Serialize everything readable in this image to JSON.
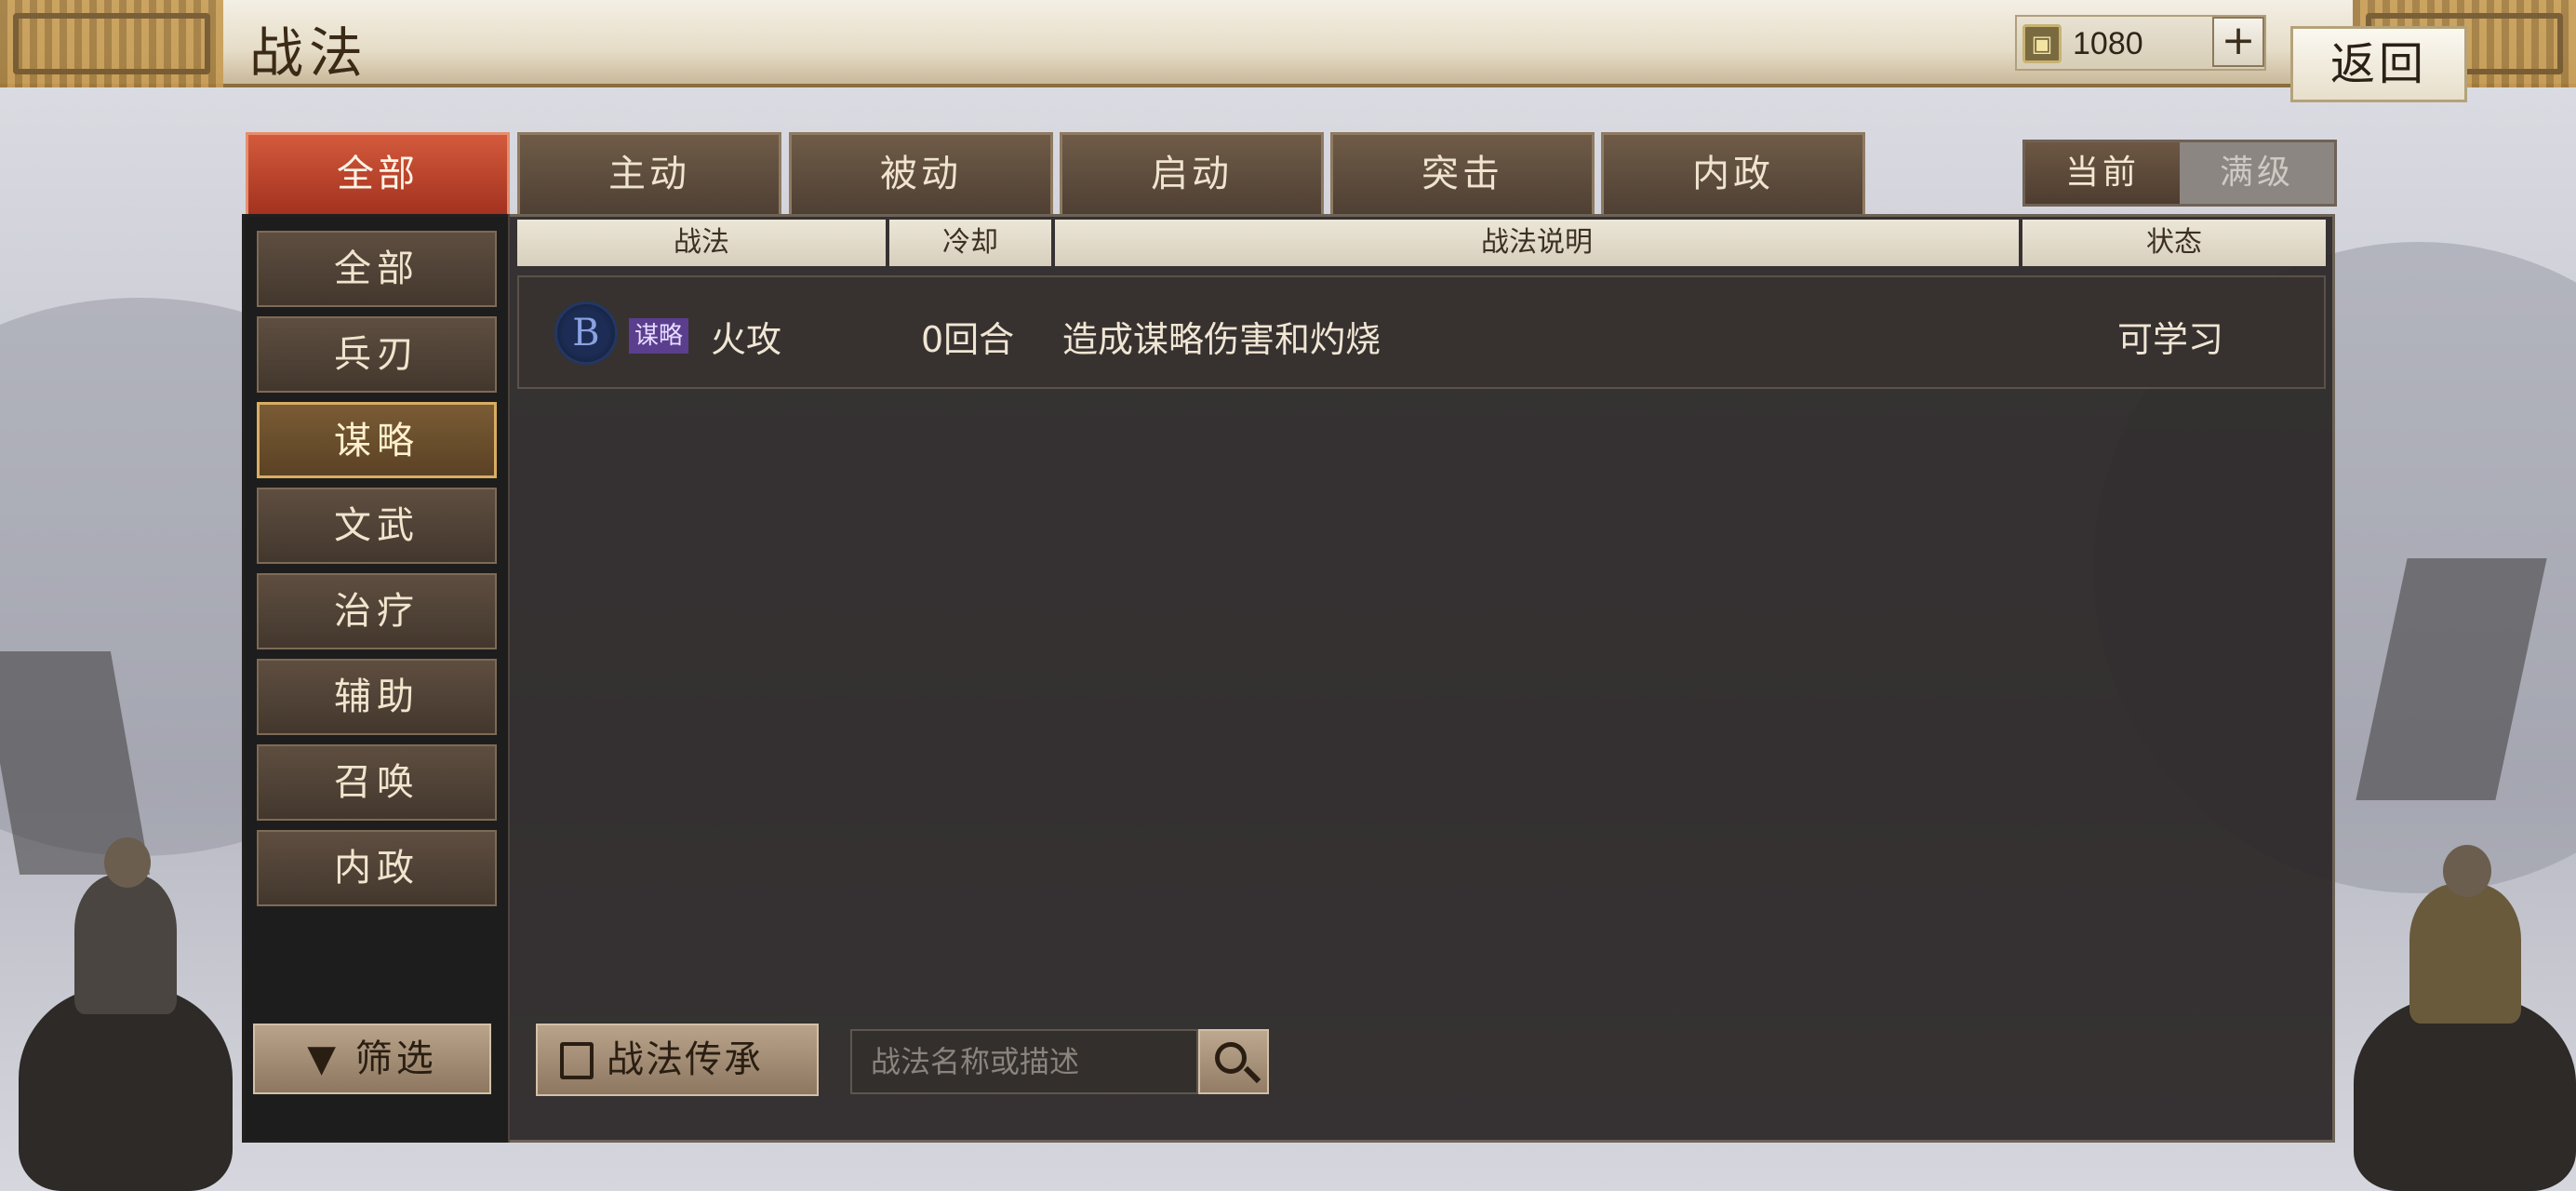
{
  "header": {
    "title": "战法",
    "currency_value": "1080",
    "currency_icon": "treasure-box-icon",
    "plus_label": "+",
    "back_label": "返回"
  },
  "tabs": [
    {
      "label": "全部",
      "active": true
    },
    {
      "label": "主动",
      "active": false
    },
    {
      "label": "被动",
      "active": false
    },
    {
      "label": "启动",
      "active": false
    },
    {
      "label": "突击",
      "active": false
    },
    {
      "label": "内政",
      "active": false
    }
  ],
  "level_toggle": {
    "current": "当前",
    "max": "满级",
    "selected": "当前"
  },
  "sidebar": {
    "items": [
      {
        "label": "全部",
        "active": false
      },
      {
        "label": "兵刃",
        "active": false
      },
      {
        "label": "谋略",
        "active": true
      },
      {
        "label": "文武",
        "active": false
      },
      {
        "label": "治疗",
        "active": false
      },
      {
        "label": "辅助",
        "active": false
      },
      {
        "label": "召唤",
        "active": false
      },
      {
        "label": "内政",
        "active": false
      }
    ],
    "filter_label": "筛选"
  },
  "table": {
    "columns": [
      "战法",
      "冷却",
      "战法说明",
      "状态"
    ],
    "rows": [
      {
        "grade": "B",
        "type": "谋略",
        "name": "火攻",
        "cooldown": "0回合",
        "description": "造成谋略伤害和灼烧",
        "status": "可学习"
      }
    ]
  },
  "bottom": {
    "inherit_label": "战法传承",
    "search_placeholder": "战法名称或描述"
  },
  "colors": {
    "active_tab": "#c0462d",
    "tab": "#5e4c3d",
    "panel": "#2a2626",
    "sidebar_active_border": "#d8ae62",
    "type_badge": "#5b3e8e"
  }
}
